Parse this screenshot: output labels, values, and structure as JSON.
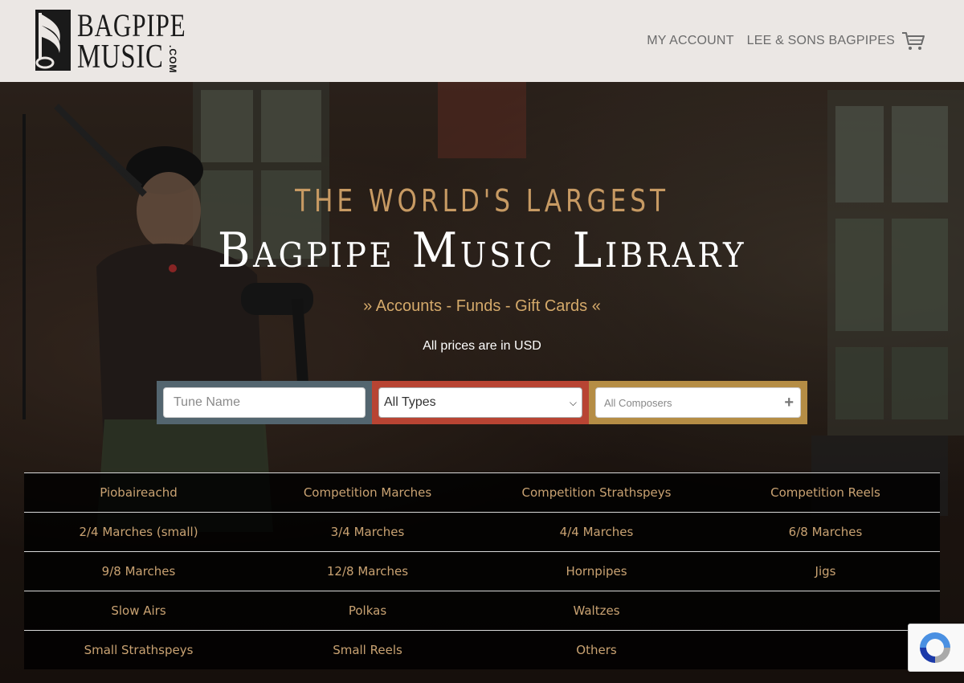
{
  "header": {
    "logo": {
      "line1": "BAGPIPE",
      "line2": "MUSIC",
      "suffix": ".COM"
    },
    "nav": [
      {
        "label": "MY ACCOUNT"
      },
      {
        "label": "LEE & SONS BAGPIPES"
      }
    ],
    "cart_icon": "shopping-cart-icon"
  },
  "hero": {
    "heading_small": "THE WORLD'S LARGEST",
    "heading_big": "Bagpipe Music Library",
    "links": {
      "prefix": "»",
      "items": [
        "Accounts",
        "Funds",
        "Gift Cards"
      ],
      "separator": "-",
      "suffix": "«"
    },
    "prices_note": "All prices are in USD"
  },
  "search": {
    "tune_placeholder": "Tune Name",
    "type_selected": "All Types",
    "composer_placeholder": "All Composers",
    "colors": {
      "tune": "#53656f",
      "type": "#b84433",
      "composer": "#b58d45"
    }
  },
  "categories": [
    [
      "Piobaireachd",
      "Competition Marches",
      "Competition Strathspeys",
      "Competition Reels"
    ],
    [
      "2/4 Marches (small)",
      "3/4 Marches",
      "4/4 Marches",
      "6/8 Marches"
    ],
    [
      "9/8 Marches",
      "12/8 Marches",
      "Hornpipes",
      "Jigs"
    ],
    [
      "Slow Airs",
      "Polkas",
      "Waltzes",
      ""
    ],
    [
      "Small Strathspeys",
      "Small Reels",
      "Others",
      ""
    ]
  ],
  "theme": {
    "accent": "#c9a272",
    "header_bg": "#ebe7e4"
  }
}
